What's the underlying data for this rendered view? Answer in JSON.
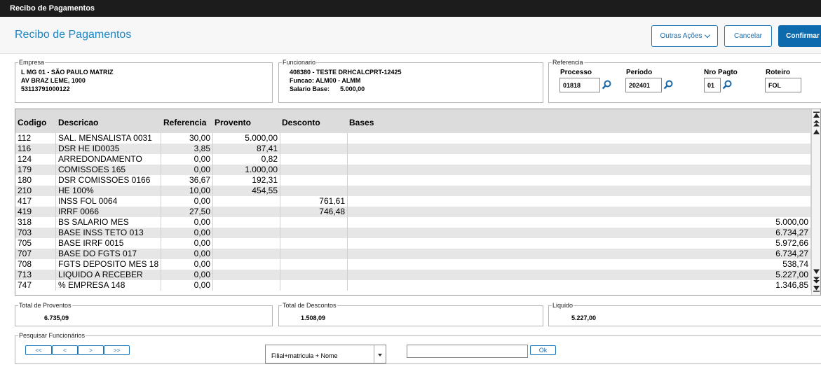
{
  "window": {
    "title": "Recibo de Pagamentos"
  },
  "header": {
    "title": "Recibo de Pagamentos",
    "actions": {
      "outras_acoes": "Outras Ações",
      "cancelar": "Cancelar",
      "confirmar": "Confirmar"
    }
  },
  "empresa": {
    "legend": "Empresa",
    "lines": [
      "L MG 01  - SÃO PAULO MATRIZ",
      "AV BRAZ LEME, 1000",
      "53113791000122"
    ]
  },
  "funcionario": {
    "legend": "Funcionario",
    "line1": "408380 - TESTE DRHCALCPRT-12425",
    "line2": "Funcao: ALM00 - ALMM",
    "salario_label": "Salario Base:",
    "salario_value": "5.000,00"
  },
  "referencia": {
    "legend": "Referencia",
    "processo": {
      "label": "Processo",
      "value": "01818"
    },
    "periodo": {
      "label": "Período",
      "value": "202401"
    },
    "nro_pagto": {
      "label": "Nro Pagto",
      "value": "01"
    },
    "roteiro": {
      "label": "Roteiro",
      "value": "FOL"
    }
  },
  "grid": {
    "columns": [
      "Codigo",
      "Descricao",
      "Referencia",
      "Provento",
      "Desconto",
      "Bases"
    ],
    "rows": [
      [
        "112",
        "SAL. MENSALISTA 0031",
        "30,00",
        "5.000,00",
        "",
        ""
      ],
      [
        "116",
        "DSR HE ID0035",
        "3,85",
        "87,41",
        "",
        ""
      ],
      [
        "124",
        "ARREDONDAMENTO",
        "0,00",
        "0,82",
        "",
        ""
      ],
      [
        "179",
        "COMISSOES 165",
        "0,00",
        "1.000,00",
        "",
        ""
      ],
      [
        "180",
        "DSR COMISSOES 0166",
        "36,67",
        "192,31",
        "",
        ""
      ],
      [
        "210",
        "HE 100%",
        "10,00",
        "454,55",
        "",
        ""
      ],
      [
        "417",
        "INSS FOL 0064",
        "0,00",
        "",
        "761,61",
        ""
      ],
      [
        "419",
        "IRRF 0066",
        "27,50",
        "",
        "746,48",
        ""
      ],
      [
        "318",
        "BS SALARIO MES",
        "0,00",
        "",
        "",
        "5.000,00"
      ],
      [
        "703",
        "BASE INSS TETO 013",
        "0,00",
        "",
        "",
        "6.734,27"
      ],
      [
        "705",
        "BASE IRRF 0015",
        "0,00",
        "",
        "",
        "5.972,66"
      ],
      [
        "707",
        "BASE DO FGTS 017",
        "0,00",
        "",
        "",
        "6.734,27"
      ],
      [
        "708",
        "FGTS DEPOSITO MES 18",
        "0,00",
        "",
        "",
        "538,74"
      ],
      [
        "713",
        "LIQUIDO A RECEBER",
        "0,00",
        "",
        "",
        "5.227,00"
      ],
      [
        "747",
        "% EMPRESA 148",
        "0,00",
        "",
        "",
        "1.346,85"
      ]
    ]
  },
  "totais": {
    "proventos": {
      "label": "Total de Proventos",
      "value": "6.735,09"
    },
    "descontos": {
      "label": "Total de Descontos",
      "value": "1.508,09"
    },
    "liquido": {
      "label": "Liquido",
      "value": "5.227,00"
    }
  },
  "pesquisa": {
    "legend": "Pesquisar Funcionários",
    "nav": [
      "<<",
      "<",
      ">",
      ">>"
    ],
    "select_value": "Filial+matricula + Nome",
    "search_value": "",
    "ok": "Ok"
  }
}
